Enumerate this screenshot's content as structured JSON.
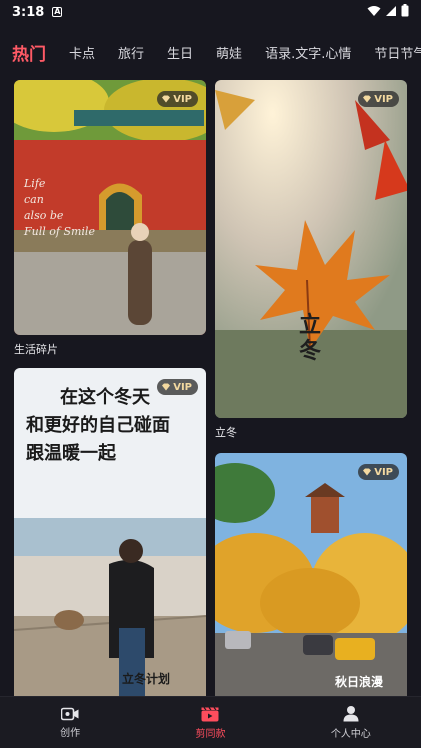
{
  "status": {
    "time": "3:18",
    "a_icon": "A"
  },
  "tabs": [
    "热门",
    "卡点",
    "旅行",
    "生日",
    "萌娃",
    "语录.文字.心情",
    "节日节气"
  ],
  "cards": [
    {
      "title": "生活碎片",
      "vip": "VIP",
      "overlay_text": [
        "Life",
        "can",
        "also be",
        "Full of Smile"
      ]
    },
    {
      "title": "立冬",
      "vip": "VIP",
      "overlay_text": [
        "立",
        "冬"
      ]
    },
    {
      "title": "",
      "vip": "VIP",
      "overlay_text": [
        "在这个冬天",
        "和更好的自己碰面",
        "跟温暖一起"
      ],
      "signature": "立冬计划"
    },
    {
      "title": "",
      "vip": "VIP",
      "overlay_text": [],
      "signature": "秋日浪漫"
    }
  ],
  "bottom_nav": [
    {
      "label": "创作",
      "icon": "camera-icon"
    },
    {
      "label": "剪同款",
      "icon": "clapperboard-icon"
    },
    {
      "label": "个人中心",
      "icon": "person-icon"
    }
  ],
  "colors": {
    "accent": "#ff4d5d",
    "background": "#17171f",
    "vip_text": "#f3d9a0"
  }
}
